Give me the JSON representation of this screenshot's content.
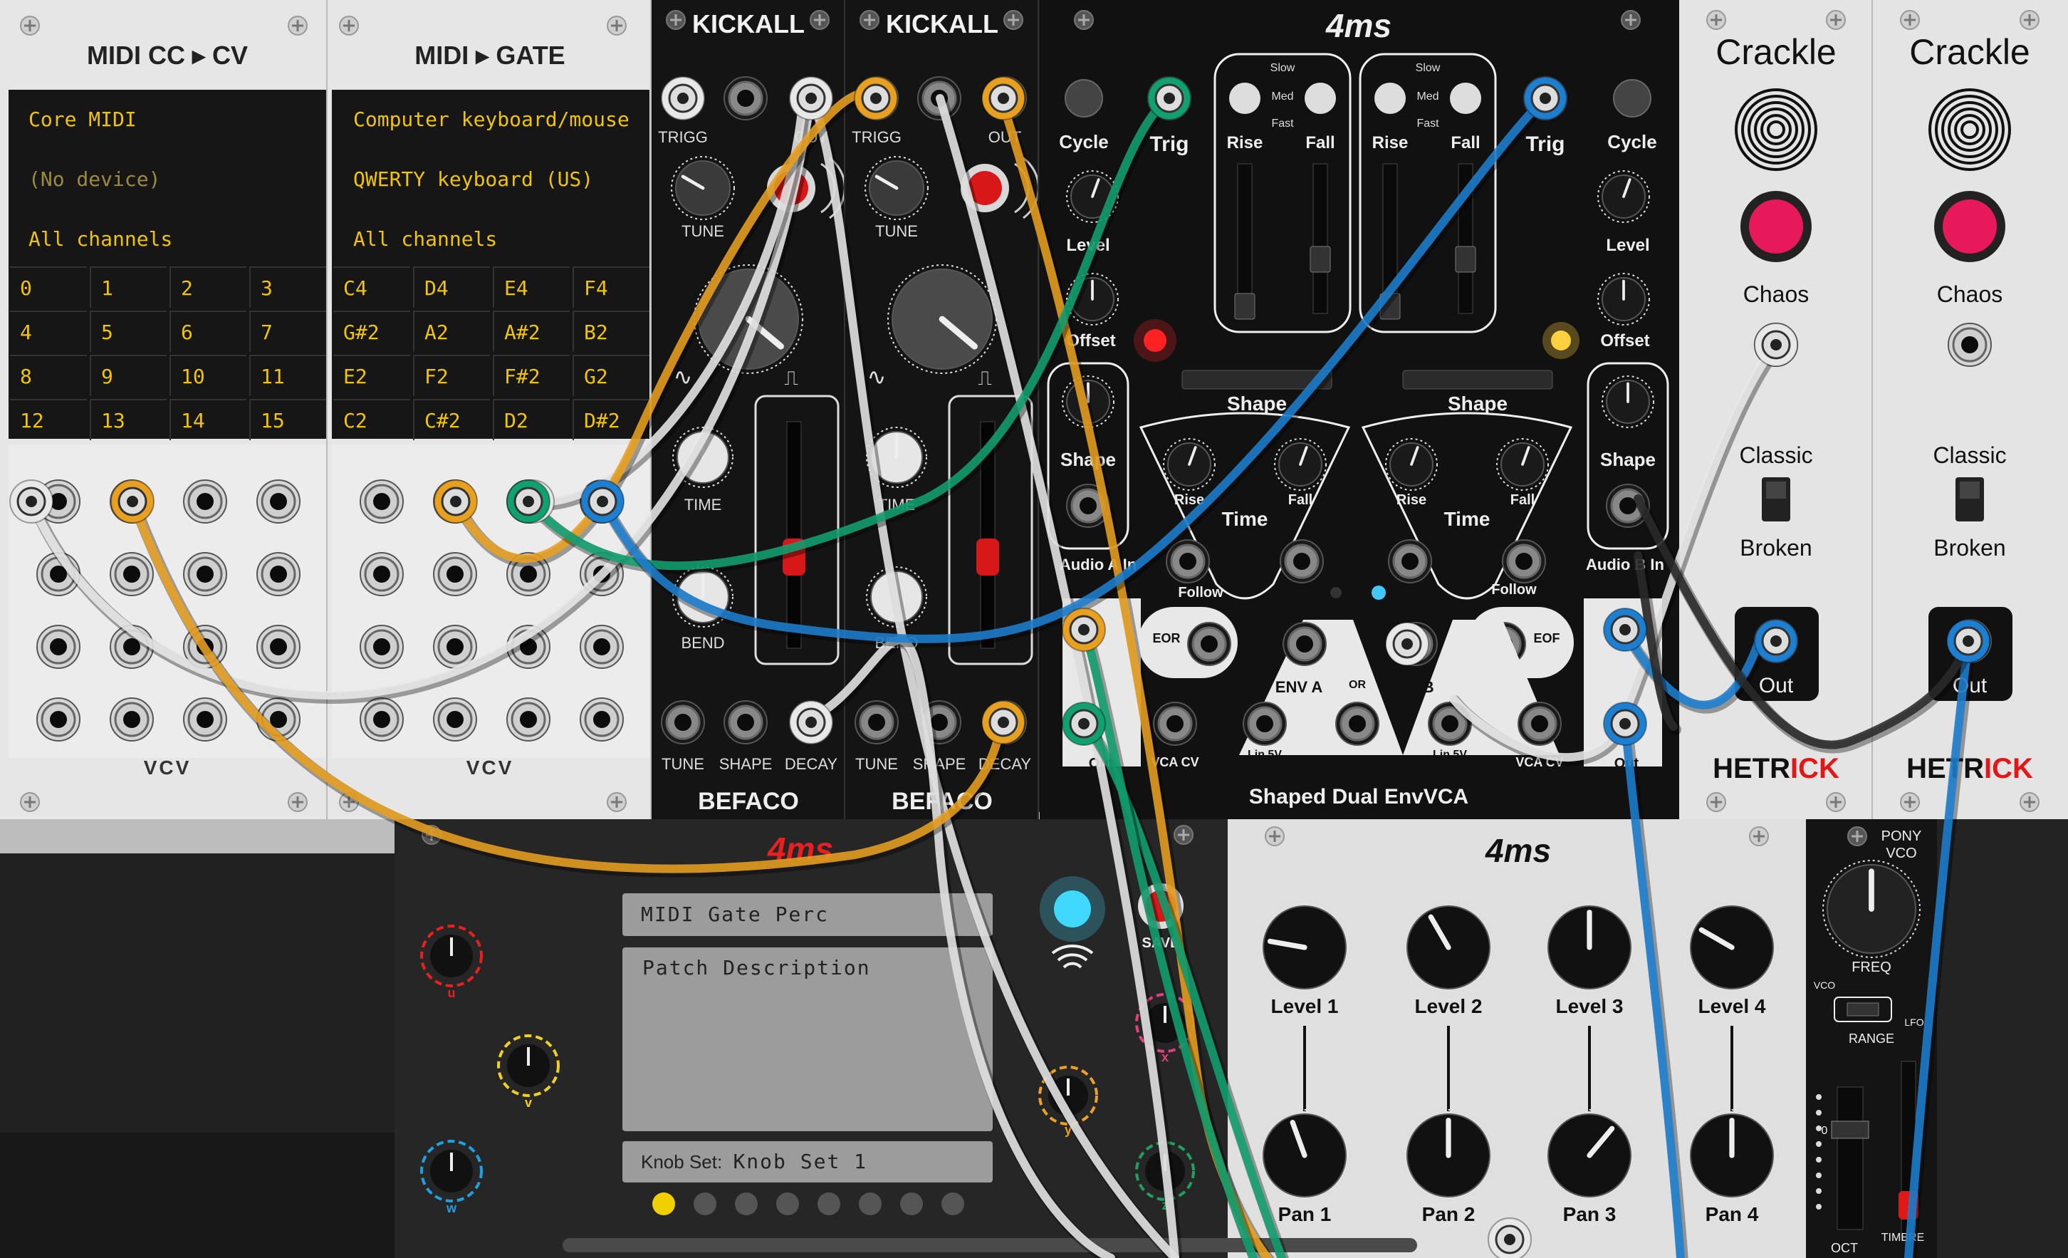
{
  "midi_cc": {
    "title": "MIDI CC ▸ CV",
    "driver": "Core MIDI",
    "device": "(No device)",
    "channel": "All channels",
    "cells": [
      "0",
      "1",
      "2",
      "3",
      "4",
      "5",
      "6",
      "7",
      "8",
      "9",
      "10",
      "11",
      "12",
      "13",
      "14",
      "15"
    ],
    "brand": "VCV"
  },
  "midi_gate": {
    "title": "MIDI ▸ GATE",
    "driver": "Computer keyboard/mouse",
    "device": "QWERTY keyboard (US)",
    "channel": "All channels",
    "cells": [
      "C4",
      "D4",
      "E4",
      "F4",
      "G#2",
      "A2",
      "A#2",
      "B2",
      "E2",
      "F2",
      "F#2",
      "G2",
      "C2",
      "C#2",
      "D2",
      "D#2"
    ],
    "brand": "VCV"
  },
  "kickall": {
    "title": "KICKALL",
    "brand": "BEFACO",
    "labels": {
      "trigg": "TRIGG",
      "out": "OUT",
      "tune": "TUNE",
      "time": "TIME",
      "bend": "BEND",
      "shape": "SHAPE",
      "decay": "DECAY",
      "sine": "∿",
      "square": "⎍"
    }
  },
  "envvca": {
    "title": "Shaped Dual EnvVCA",
    "labels": {
      "cycle": "Cycle",
      "trig": "Trig",
      "level": "Level",
      "offset": "Offset",
      "shape": "Shape",
      "audio_a_in": "Audio A In",
      "audio_b_in": "Audio B In",
      "out": "Out",
      "slow": "Slow",
      "med": "Med",
      "fast": "Fast",
      "rise": "Rise",
      "fall": "Fall",
      "time": "Time",
      "follow": "Follow",
      "eor": "EOR",
      "eof": "EOF",
      "env_a": "ENV A",
      "env_b": "ENV B",
      "or": "OR",
      "lin5v": "Lin 5V",
      "vca_cv": "VCA CV"
    }
  },
  "crackle": {
    "title": "Crackle",
    "chaos": "Chaos",
    "classic": "Classic",
    "broken": "Broken",
    "out": "Out",
    "brand_a": "HETR",
    "brand_b": "ICK"
  },
  "stoermelder": {
    "patch_name": "MIDI Gate Perc",
    "description": "Patch Description",
    "knobset_label": "Knob Set:",
    "knobset_value": "Knob Set 1",
    "save": "SAVE",
    "knobs": [
      "u",
      "v",
      "w",
      "x",
      "y",
      "z"
    ]
  },
  "mixer": {
    "levels": [
      "Level 1",
      "Level 2",
      "Level 3",
      "Level 4"
    ],
    "pans": [
      "Pan 1",
      "Pan 2",
      "Pan 3",
      "Pan 4"
    ]
  },
  "pony": {
    "title_a": "PONY",
    "title_b": "VCO",
    "freq": "FREQ",
    "vco": "VCO",
    "lfo": "LFO",
    "range": "RANGE",
    "oct": "OCT",
    "oct_value": "0",
    "timbre": "TIMBRE"
  },
  "colors": {
    "cable_white": "#e8e8e8",
    "cable_orange": "#e8a020",
    "cable_green": "#12a070",
    "cable_blue": "#1e7fd0",
    "cable_black": "#2a2a2a",
    "lcd_text": "#f0c400",
    "led_red": "#ff2020",
    "led_blue": "#40d8ff",
    "led_yellow": "#ffd040"
  }
}
